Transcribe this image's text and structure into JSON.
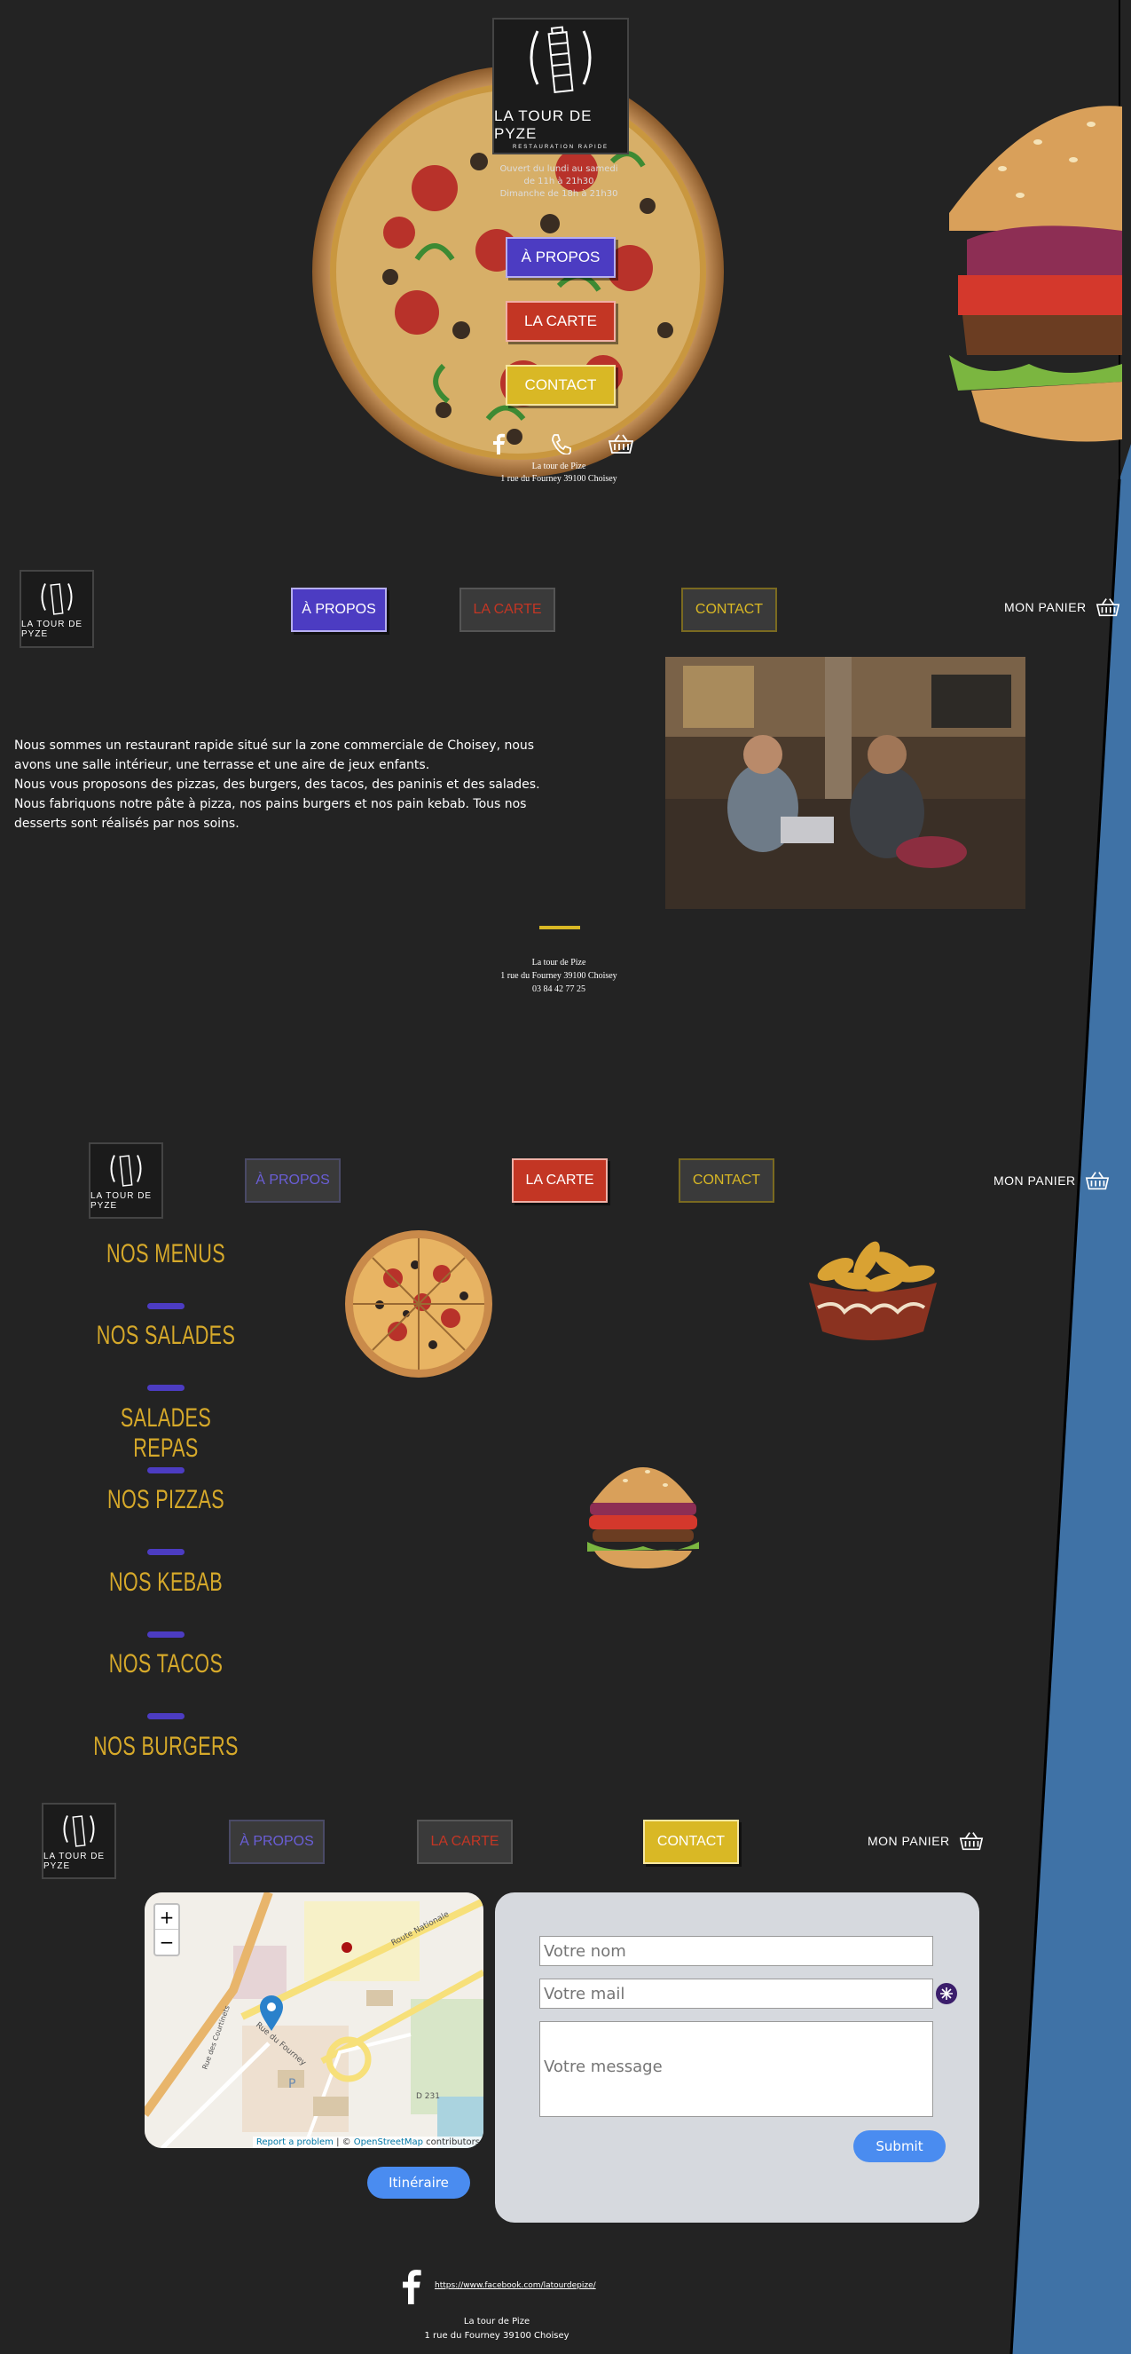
{
  "brand": {
    "name": "LA TOUR DE PYZE",
    "tagline": "RESTAURATION RAPIDE"
  },
  "hero": {
    "hours": [
      "Ouvert du lundi au samedi",
      "de 11h à 21h30",
      "Dimanche de 18h à 21h30"
    ],
    "buttons": {
      "apropos": "À PROPOS",
      "carte": "LA CARTE",
      "contact": "CONTACT"
    },
    "address_line1": "La tour de Pize",
    "address_line2": "1 rue du Fourney 39100 Choisey"
  },
  "nav": {
    "apropos": "À PROPOS",
    "carte": "LA CARTE",
    "contact": "CONTACT",
    "cart": "MON PANIER"
  },
  "about": {
    "text_lines": [
      "Nous sommes un restaurant rapide situé sur la zone commerciale de Choisey, nous",
      "avons une salle intérieur, une terrasse et une aire de jeux enfants.",
      "Nous vous proposons des pizzas, des burgers, des tacos, des paninis et des salades.",
      "Nous fabriquons notre pâte à pizza, nos pains burgers et nos pain kebab. Tous nos",
      "desserts sont réalisés par nos soins."
    ],
    "footer": [
      "La tour de Pize",
      "1 rue du Fourney 39100 Choisey",
      "03 84 42 77 25"
    ]
  },
  "menu": {
    "categories": [
      "NOS MENUS",
      "NOS SALADES",
      "SALADES REPAS",
      "NOS PIZZAS",
      "NOS KEBAB",
      "NOS TACOS",
      "NOS BURGERS"
    ]
  },
  "contact": {
    "map": {
      "zoom_in": "+",
      "zoom_out": "−",
      "attribution_link": "Report a problem",
      "attribution_sep": " | © ",
      "attribution_osm": "OpenStreetMap",
      "attribution_tail": " contributors",
      "road_labels": [
        "Route Nationale",
        "Rue du Fourney",
        "Rue des Courtinets",
        "D 231"
      ],
      "marker_label": "P"
    },
    "itinerary_button": "Itinéraire",
    "form": {
      "name_placeholder": "Votre nom",
      "mail_placeholder": "Votre mail",
      "message_placeholder": "Votre message",
      "submit": "Submit"
    },
    "facebook_url": "https://www.facebook.com/latourdepize/",
    "footer": [
      "La tour de Pize",
      "1 rue du Fourney 39100 Choisey"
    ]
  },
  "colors": {
    "bg": "#232323",
    "purple": "#4c3cc2",
    "red": "#c33624",
    "yellow": "#d9b825",
    "gold": "#d6a92a",
    "blue_stripe": "#3f72a6",
    "submit_blue": "#4a8cf0",
    "form_bg": "#d6d9de"
  },
  "icons": [
    "facebook-icon",
    "phone-icon",
    "basket-icon",
    "map-marker-icon",
    "captcha-icon"
  ]
}
